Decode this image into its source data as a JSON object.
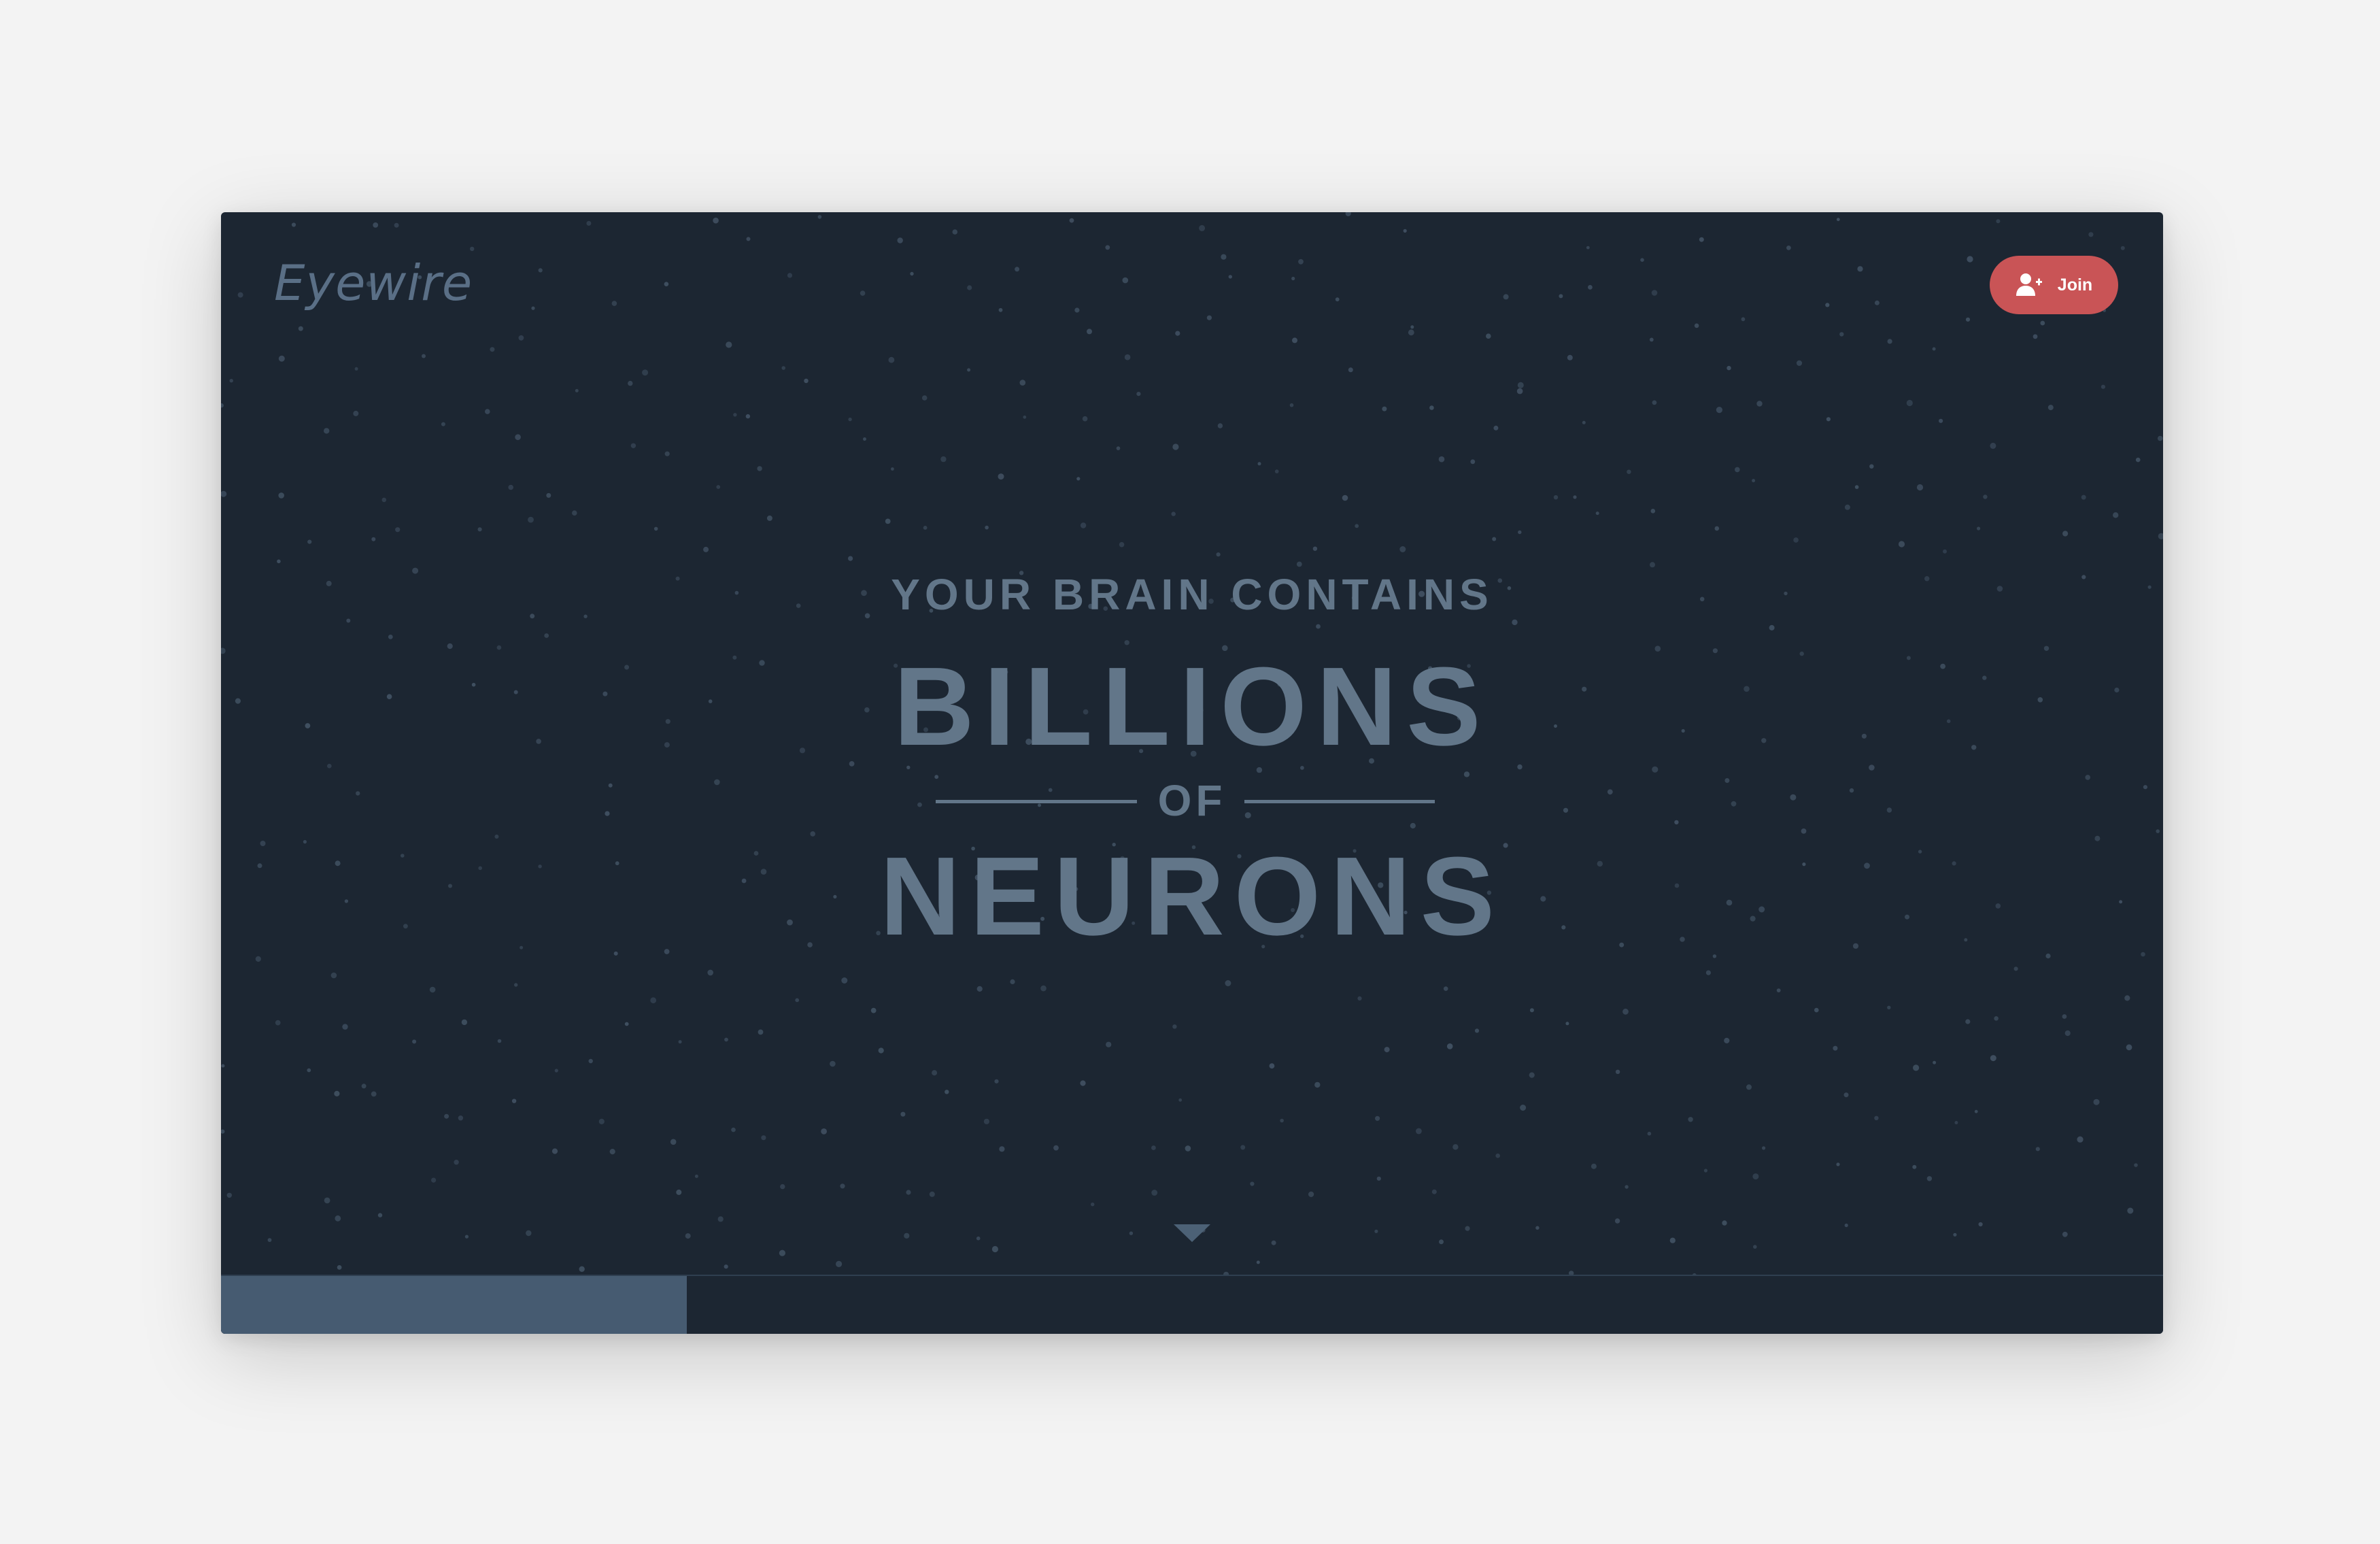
{
  "header": {
    "logo_text": "Eyewire",
    "join_label": "Join",
    "join_icon": "user-plus-icon"
  },
  "hero": {
    "line1": "YOUR BRAIN CONTAINS",
    "line2": "BILLIONS",
    "line3": "OF",
    "line4": "NEURONS"
  },
  "scroll": {
    "icon": "triangle-down-icon"
  },
  "progress": {
    "fraction": 0.24
  },
  "colors": {
    "background": "#1c2632",
    "hero_text": "#627689",
    "join_button": "#c95456",
    "progress_fill": "#465b71",
    "star": "#3f4f60"
  }
}
